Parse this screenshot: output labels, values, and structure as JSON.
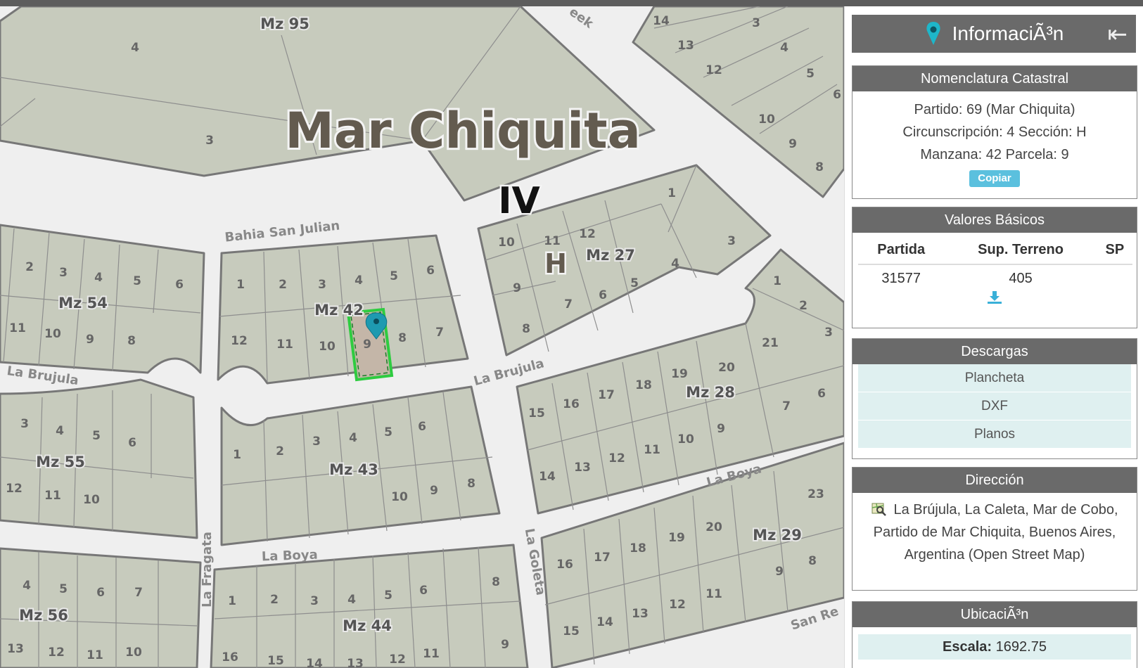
{
  "map": {
    "title": "Mar Chiquita",
    "circunscripcion": "IV",
    "seccion": "H",
    "manzanas": [
      "Mz 95",
      "Mz 54",
      "Mz 42",
      "Mz 27",
      "Mz 55",
      "Mz 43",
      "Mz 28",
      "Mz 56",
      "Mz 44",
      "Mz 29"
    ],
    "streets": [
      "Bahia San Julian",
      "La Brujula",
      "La Brujula",
      "La Boya",
      "La Boya",
      "La Fragata",
      "La Goleta",
      "San Re",
      "eek"
    ],
    "selected_parcel": "9",
    "colors": {
      "parcel": "#c7cbbd",
      "selection": "#2ecc40",
      "marker": "#1e9ab0"
    }
  },
  "panel": {
    "title": "InformaciÃ³n",
    "nomenclatura": {
      "header": "Nomenclatura Catastral",
      "line1": "Partido: 69 (Mar Chiquita)",
      "line2": "Circunscripción: 4 Sección: H",
      "line3": "Manzana: 42 Parcela: 9",
      "copy_label": "Copiar"
    },
    "valores": {
      "header": "Valores Básicos",
      "columns": [
        "Partida",
        "Sup. Terreno",
        "SP"
      ],
      "row": [
        "31577",
        "405",
        ""
      ]
    },
    "descargas": {
      "header": "Descargas",
      "items": [
        "Plancheta",
        "DXF",
        "Planos"
      ]
    },
    "direccion": {
      "header": "Dirección",
      "text": "La Brújula, La Caleta, Mar de Cobo, Partido de Mar Chiquita, Buenos Aires, Argentina (Open Street Map)"
    },
    "ubicacion": {
      "header": "UbicaciÃ³n",
      "scale_label": "Escala:",
      "scale_value": "1692.75"
    }
  }
}
